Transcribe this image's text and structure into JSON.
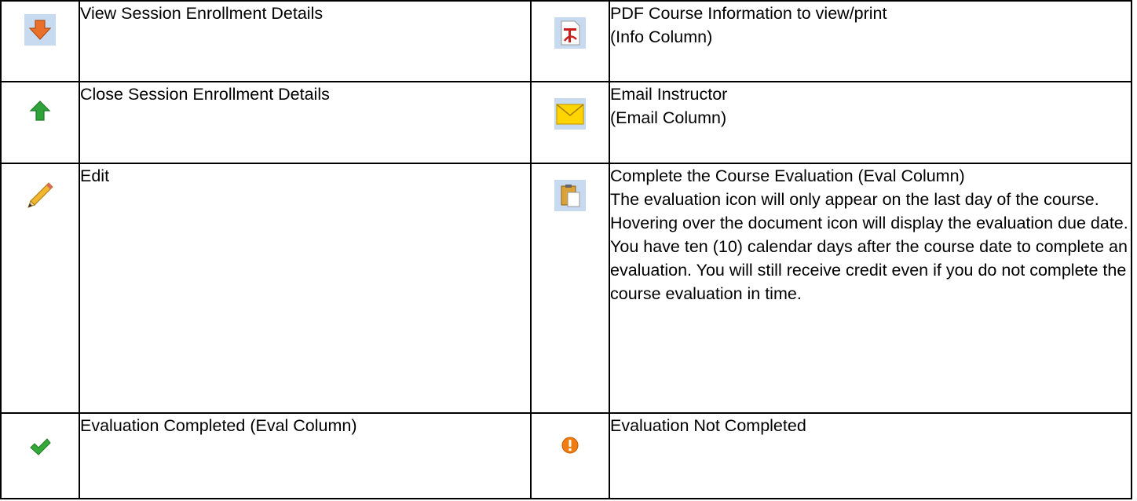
{
  "rows": [
    {
      "left_icon": "orange-arrow-down-icon",
      "left_text": [
        "View Session Enrollment Details"
      ],
      "right_icon": "pdf-icon",
      "right_text": [
        "PDF Course Information to view/print",
        "(Info Column)"
      ]
    },
    {
      "left_icon": "green-arrow-up-icon",
      "left_text": [
        "Close Session Enrollment Details"
      ],
      "right_icon": "envelope-icon",
      "right_text": [
        "Email Instructor",
        "(Email Column)"
      ]
    },
    {
      "left_icon": "pencil-icon",
      "left_text": [
        "Edit"
      ],
      "right_icon": "clipboard-icon",
      "right_text": [
        "Complete the Course Evaluation (Eval Column)",
        "The evaluation icon will only appear on the last day of the course.  Hovering over the document icon will display the evaluation due date. You have ten (10) calendar days after the course date to complete an evaluation.  You will still receive credit even if you do not complete the course evaluation in time."
      ]
    },
    {
      "left_icon": "green-checkmark-icon",
      "left_text": [
        "Evaluation Completed (Eval Column)"
      ],
      "right_icon": "orange-exclamation-icon",
      "right_text": [
        "Evaluation Not Completed"
      ]
    }
  ],
  "colors": {
    "icon_bg": "#c8daf0",
    "arrow_orange": "#e8702a",
    "arrow_green": "#2fa33a",
    "pdf_red": "#c9201c",
    "envelope_yellow": "#ffd400",
    "check_green": "#35a83a",
    "alert_orange": "#f07d12"
  }
}
